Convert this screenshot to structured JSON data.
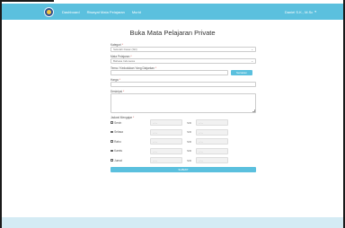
{
  "navbar": {
    "links": [
      "Dashboard",
      "Riwayat Mata Pelajaran",
      "Murid"
    ],
    "user": "Daniel S.K., M.Sc",
    "user_caret": "▾"
  },
  "page": {
    "title": "Buka Mata Pelajaran Private"
  },
  "form": {
    "kategori_label": "Kategori",
    "kategori_value": "Sekolah Dasar (SD)",
    "mapel_label": "Mata Pelajaran",
    "mapel_value": "Bahasa Indonesia",
    "tema_label": "Tema / Kedudukan Yang Diajarkan",
    "tema_value": "",
    "search_button": "Sertakan",
    "harga_label": "Harga",
    "harga_value": "",
    "deskripsi_label": "Deskripsi",
    "jadwal_label": "Jadwal Mengajar",
    "required_mark": "*",
    "schedule": [
      {
        "day": "Senin",
        "from": "--:--",
        "sep": "S/D",
        "to": "--:--"
      },
      {
        "day": "Selasa",
        "from": "--:--",
        "sep": "S/D",
        "to": "--:--"
      },
      {
        "day": "Rabu",
        "from": "--:--",
        "sep": "S/D",
        "to": "--:--"
      },
      {
        "day": "Kamis",
        "from": "--:--",
        "sep": "S/D",
        "to": "--:--"
      },
      {
        "day": "Jumat",
        "from": "--:--",
        "sep": "S/D",
        "to": "--:--"
      }
    ],
    "submit_label": "SUBMIT"
  },
  "colors": {
    "accent": "#5bc0de",
    "footer": "#d4ebf4"
  }
}
